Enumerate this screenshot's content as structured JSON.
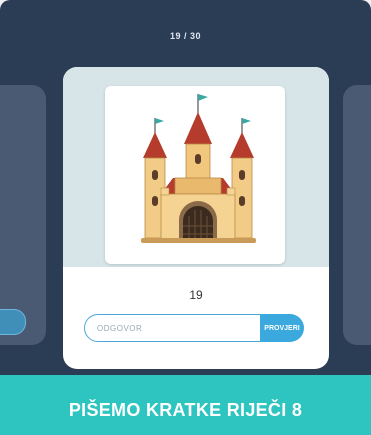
{
  "progress": {
    "counter": "19 / 30"
  },
  "card": {
    "image_icon": "castle-icon",
    "number": "19",
    "input": {
      "value": "",
      "placeholder": "ODGOVOR"
    },
    "submit_label": "PROVJERI"
  },
  "footer": {
    "title": "PIŠEMO KRATKE RIJEČI 8"
  },
  "colors": {
    "stage": "#2b3c55",
    "card_top": "#d7e5e9",
    "accent": "#3ba9dd",
    "footer": "#2ec4bf"
  }
}
